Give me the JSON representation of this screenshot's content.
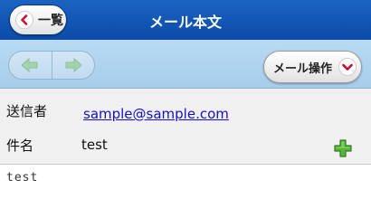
{
  "header": {
    "back_label": "一覧",
    "title": "メール本文"
  },
  "toolbar": {
    "prev_icon": "arrow-left-icon",
    "next_icon": "arrow-right-icon",
    "mail_ops_label": "メール操作",
    "mail_ops_icon": "chevron-down-icon"
  },
  "mail": {
    "sender_label": "送信者",
    "sender": "sample@sample.com",
    "subject_label": "件名",
    "subject": "test",
    "attach_icon": "plus-icon",
    "body": "test"
  },
  "colors": {
    "header_bg": "#0c4ca8",
    "toolbar_bg": "#b4d7f1",
    "link": "#1a0dcc",
    "accent_red": "#c8102e",
    "plus_green": "#4aa532"
  }
}
